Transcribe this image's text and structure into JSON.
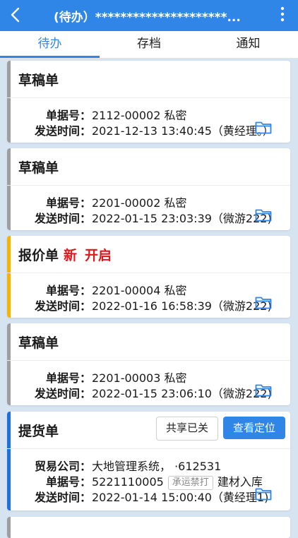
{
  "header": {
    "title": "(待办）*********************...",
    "back_icon": "chevron-left-icon",
    "more_icon": "more-vertical-icon"
  },
  "tabs": [
    {
      "label": "待办",
      "active": true
    },
    {
      "label": "存档",
      "active": false
    },
    {
      "label": "通知",
      "active": false
    }
  ],
  "cards": [
    {
      "title": "草稿单",
      "bar_color": "#9e9e9e",
      "bill_label": "单据号：",
      "bill_value": "2112-00002  私密",
      "time_label": "发送时间：",
      "time_value": "2021-12-13 13:40:45（黄经理。）"
    },
    {
      "title": "草稿单",
      "bar_color": "#9e9e9e",
      "bill_label": "单据号：",
      "bill_value": "2201-00002  私密",
      "time_label": "发送时间：",
      "time_value": "2022-01-15 23:03:39（微游222)"
    },
    {
      "title": "报价单",
      "bar_color": "#f5b400",
      "tag_new": "新",
      "tag_open": "开启",
      "bill_label": "单据号：",
      "bill_value": "2201-00004  私密",
      "time_label": "发送时间：",
      "time_value": "2022-01-16 16:58:39（微游222)"
    },
    {
      "title": "草稿单",
      "bar_color": "#9e9e9e",
      "bill_label": "单据号：",
      "bill_value": "2201-00003  私密",
      "time_label": "发送时间：",
      "time_value": "2022-01-15 23:06:10（微游222)"
    },
    {
      "title": "提货单",
      "bar_color": "#1f6fe0",
      "share_button": "共享已关",
      "locate_button": "查看定位",
      "company_label": "贸易公司：",
      "company_value": "大地管理系统，   ·612531",
      "bill_label": "单据号：",
      "bill_number": "5221110005",
      "bill_stamp": "承运禁打",
      "bill_note": "建材入库",
      "time_label": "发送时间：",
      "time_value": "2022-01-14 15:00:40（黄经理1)"
    }
  ],
  "colors": {
    "primary": "#2f86e6",
    "accent_red": "#e0171c",
    "background": "#d6e3f1"
  },
  "folder_icon": "folder-icon"
}
